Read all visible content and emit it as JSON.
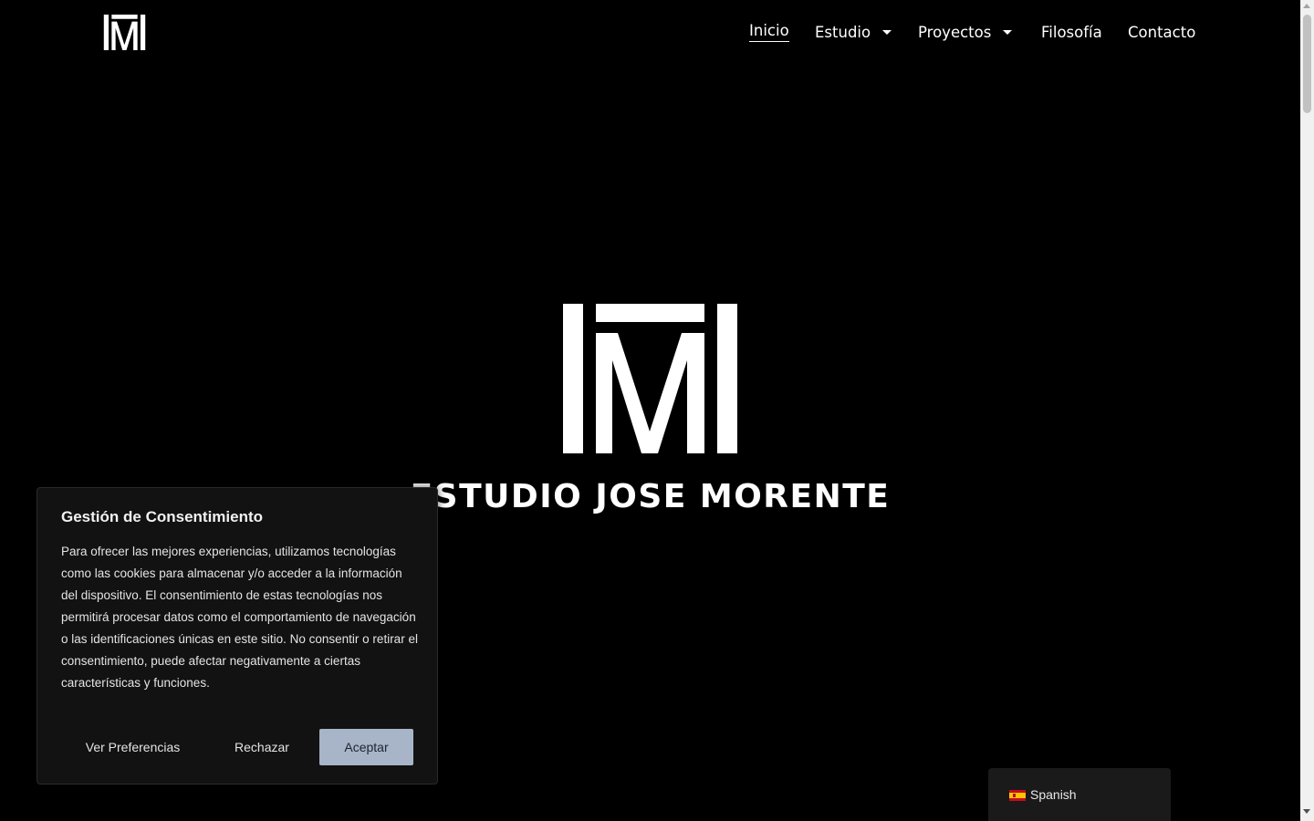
{
  "brand": {
    "logo_icon": "im-monogram-logo",
    "name": "ESTUDIO JOSE MORENTE"
  },
  "nav": {
    "items": [
      {
        "label": "Inicio",
        "active": true,
        "has_dropdown": false
      },
      {
        "label": "Estudio",
        "active": false,
        "has_dropdown": true
      },
      {
        "label": "Proyectos",
        "active": false,
        "has_dropdown": true
      },
      {
        "label": "Filosofía",
        "active": false,
        "has_dropdown": false
      },
      {
        "label": "Contacto",
        "active": false,
        "has_dropdown": false
      }
    ]
  },
  "consent": {
    "title": "Gestión de Consentimiento",
    "body": "Para ofrecer las mejores experiencias, utilizamos tecnologías como las cookies para almacenar y/o acceder a la información del dispositivo. El consentimiento de estas tecnologías nos permitirá procesar datos como el comportamiento de navegación o las identificaciones únicas en este sitio. No consentir o retirar el consentimiento, puede afectar negativamente a ciertas características y funciones.",
    "prefs_label": "Ver Preferencias",
    "reject_label": "Rechazar",
    "accept_label": "Aceptar"
  },
  "language": {
    "flag_icon": "spain-flag-icon",
    "label": "Spanish"
  },
  "colors": {
    "background": "#000000",
    "text": "#ffffff",
    "consent_bg": "#121212",
    "accept_bg": "#a8b4c8",
    "lang_bg": "#1a1a1a"
  }
}
